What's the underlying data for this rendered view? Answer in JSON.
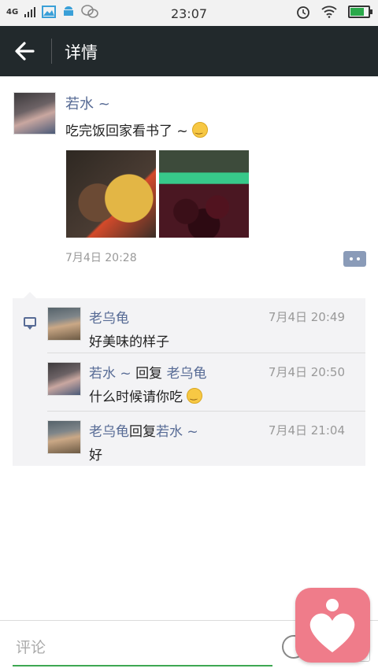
{
  "status_bar": {
    "network": "4G",
    "time": "23:07"
  },
  "app_bar": {
    "title": "详情"
  },
  "post": {
    "author": "若水 ~",
    "text": "吃完饭回家看书了 ~",
    "time": "7月4日 20:28",
    "images": [
      "food-photo",
      "cherries-photo"
    ]
  },
  "comments": [
    {
      "author": "老乌龟",
      "reply_word": "",
      "reply_to": "",
      "time": "7月4日 20:49",
      "text": "好美味的样子",
      "emoji": false
    },
    {
      "author": "若水 ~",
      "reply_word": "回复",
      "reply_to": "老乌龟",
      "time": "7月4日 20:50",
      "text": "什么时候请你吃",
      "emoji": true
    },
    {
      "author": "老乌龟",
      "reply_word": "回复",
      "reply_to": "若水 ~",
      "time": "7月4日 21:04",
      "text": "好",
      "emoji": false
    }
  ],
  "input": {
    "placeholder": "评论"
  },
  "colors": {
    "accent_link": "#576b95",
    "app_bar": "#22292c",
    "input_underline": "#3da852",
    "float_button": "#ef7c8a"
  }
}
